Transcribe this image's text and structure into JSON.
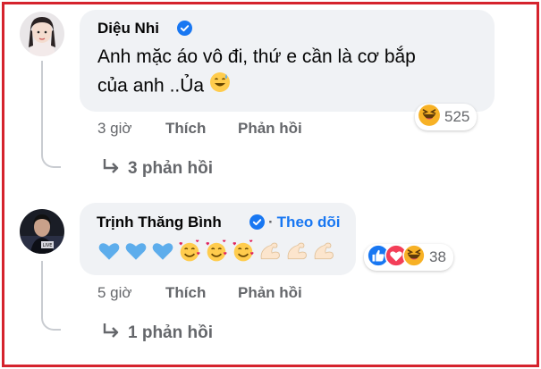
{
  "comments": [
    {
      "author": "Diệu Nhi",
      "verified": true,
      "text_line1": "Anh mặc áo vô đi, thứ e cần là cơ bắp",
      "text_line2": "của anh ..Ủa",
      "time": "3 giờ",
      "like_label": "Thích",
      "reply_label": "Phản hồi",
      "reaction_count": "525",
      "reactions": [
        "laugh"
      ],
      "replies_label": "3 phản hồi"
    },
    {
      "author": "Trịnh Thăng Bình",
      "verified": true,
      "follow_label": "Theo dõi",
      "emojis": [
        "blue-heart",
        "blue-heart",
        "blue-heart",
        "smiling-face-with-hearts",
        "smiling-face-with-hearts",
        "smiling-face-with-hearts",
        "flexed-biceps",
        "flexed-biceps",
        "flexed-biceps"
      ],
      "time": "5 giờ",
      "like_label": "Thích",
      "reply_label": "Phản hồi",
      "reaction_count": "38",
      "reactions": [
        "like",
        "love",
        "laugh"
      ],
      "replies_label": "1 phản hồi"
    }
  ],
  "colors": {
    "border": "#d5232d",
    "bubble": "#f0f2f5",
    "link": "#1877f2",
    "meta": "#65676b",
    "verified": "#1877f2"
  }
}
